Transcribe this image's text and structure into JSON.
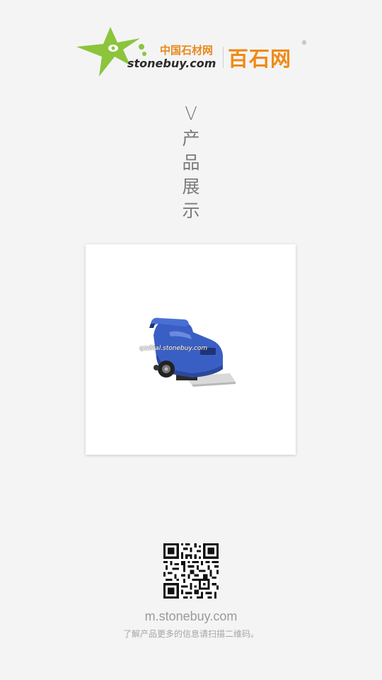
{
  "logo": {
    "cn_small": "中国石材网",
    "domain": "stonebuy.com",
    "cn_big": "百石网",
    "reg_mark": "®",
    "colors": {
      "green": "#8cc43c",
      "orange": "#ef8a16"
    }
  },
  "section": {
    "marker": "V",
    "title_chars": [
      "产",
      "品",
      "展",
      "示"
    ]
  },
  "product": {
    "image": "floor-scrubber-machine",
    "watermark": "qzdital.stonebuy.com"
  },
  "footer": {
    "qr_code": "qr-code",
    "site": "m.stonebuy.com",
    "hint": "了解产品更多的信息请扫描二维码。"
  }
}
